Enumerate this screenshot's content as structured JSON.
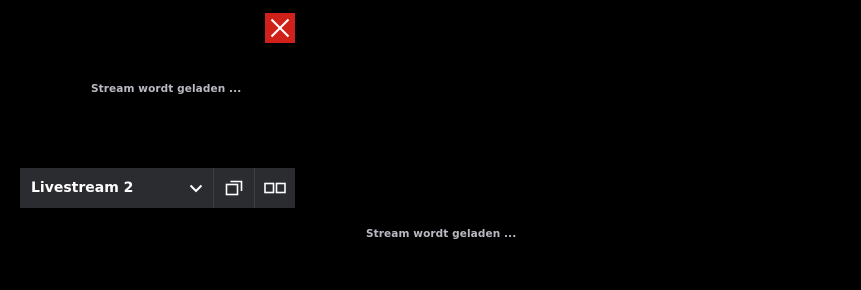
{
  "close_button": {
    "icon": "close-icon",
    "color": "#d0201a"
  },
  "player_top": {
    "loading_text": "Stream wordt geladen ..."
  },
  "stream_bar": {
    "selected_stream": "Livestream 2",
    "dropdown_icon": "chevron-down-icon",
    "popout_icon": "popout-icon",
    "split_view_icon": "split-view-icon"
  },
  "player_bottom": {
    "loading_text": "Stream wordt geladen ..."
  }
}
